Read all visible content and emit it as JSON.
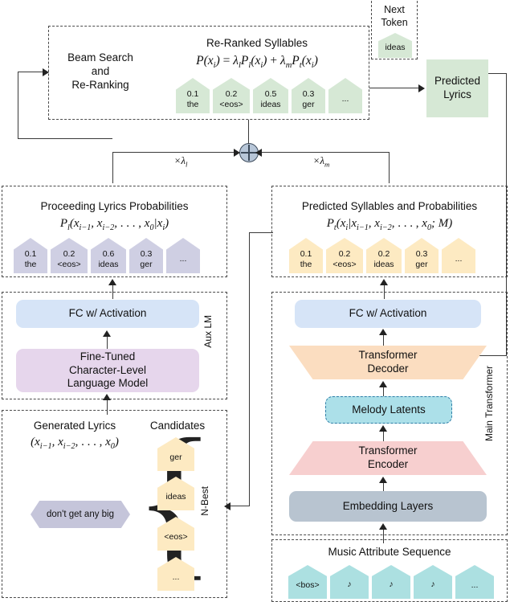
{
  "diagram": {
    "title": "Lyrics generation system architecture",
    "colors": {
      "green": "#d6e8d5",
      "purple": "#cfcfe3",
      "cream": "#fdeac2",
      "teal": "#ace0e1",
      "blue": "#d6e4f7",
      "lavender": "#e6d6ec",
      "gray": "#b8c4d0",
      "orange": "#fbddc0",
      "pink": "#f7cfcf",
      "melody": "#ace0e9",
      "sum_node": "#b7c6d8"
    }
  },
  "beam_panel": {
    "left_label_line1": "Beam Search",
    "left_label_line2": "and",
    "left_label_line3": "Re-Ranking",
    "heading": "Re-Ranked Syllables",
    "formula": "P(xi) = λl Pl(xi) + λm Pt(xi)",
    "tokens": [
      {
        "prob": "0.1",
        "text": "the"
      },
      {
        "prob": "0.2",
        "text": "<eos>"
      },
      {
        "prob": "0.5",
        "text": "ideas"
      },
      {
        "prob": "0.3",
        "text": "ger"
      },
      {
        "prob": "",
        "text": "..."
      }
    ]
  },
  "next_token": {
    "label_line1": "Next",
    "label_line2": "Token",
    "token": "ideas"
  },
  "predicted_lyrics": {
    "label_line1": "Predicted",
    "label_line2": "Lyrics"
  },
  "weights": {
    "lambda_l": "×λl",
    "lambda_m": "×λm"
  },
  "aux_lm": {
    "side_label": "Aux LM",
    "prob_panel": {
      "heading": "Proceeding Lyrics Probabilities",
      "formula": "Pl(xi−1, xi−2, . . . , x0|xi)",
      "tokens": [
        {
          "prob": "0.1",
          "text": "the"
        },
        {
          "prob": "0.2",
          "text": "<eos>"
        },
        {
          "prob": "0.6",
          "text": "ideas"
        },
        {
          "prob": "0.3",
          "text": "ger"
        },
        {
          "prob": "",
          "text": "..."
        }
      ]
    },
    "fc_label": "FC w/ Activation",
    "lm_label_line1": "Fine-Tuned",
    "lm_label_line2": "Character-Level",
    "lm_label_line3": "Language Model"
  },
  "generated_lyrics": {
    "heading": "Generated Lyrics",
    "formula": "(xi−1, xi−2, . . . , x0)",
    "lyric_text": "don't get any big",
    "candidates_heading": "Candidates",
    "nbest_label": "N-Best",
    "candidates": [
      "ger",
      "ideas",
      "<eos>",
      "..."
    ]
  },
  "main_transformer": {
    "side_label": "Main Transformer",
    "prob_panel": {
      "heading": "Predicted Syllables and Probabilities",
      "formula": "Pt(xi|xi−1, xi−2, . . . , x0; M)",
      "tokens": [
        {
          "prob": "0.1",
          "text": "the"
        },
        {
          "prob": "0.2",
          "text": "<eos>"
        },
        {
          "prob": "0.2",
          "text": "ideas"
        },
        {
          "prob": "0.3",
          "text": "ger"
        },
        {
          "prob": "",
          "text": "..."
        }
      ]
    },
    "fc_label": "FC w/ Activation",
    "decoder_line1": "Transformer",
    "decoder_line2": "Decoder",
    "melody_latents_label": "Melody Latents",
    "encoder_line1": "Transformer",
    "encoder_line2": "Encoder",
    "embedding_label": "Embedding Layers"
  },
  "music_input": {
    "heading": "Music Attribute Sequence",
    "tokens": [
      "<bos>",
      "♪",
      "♪",
      "♪",
      "..."
    ]
  }
}
